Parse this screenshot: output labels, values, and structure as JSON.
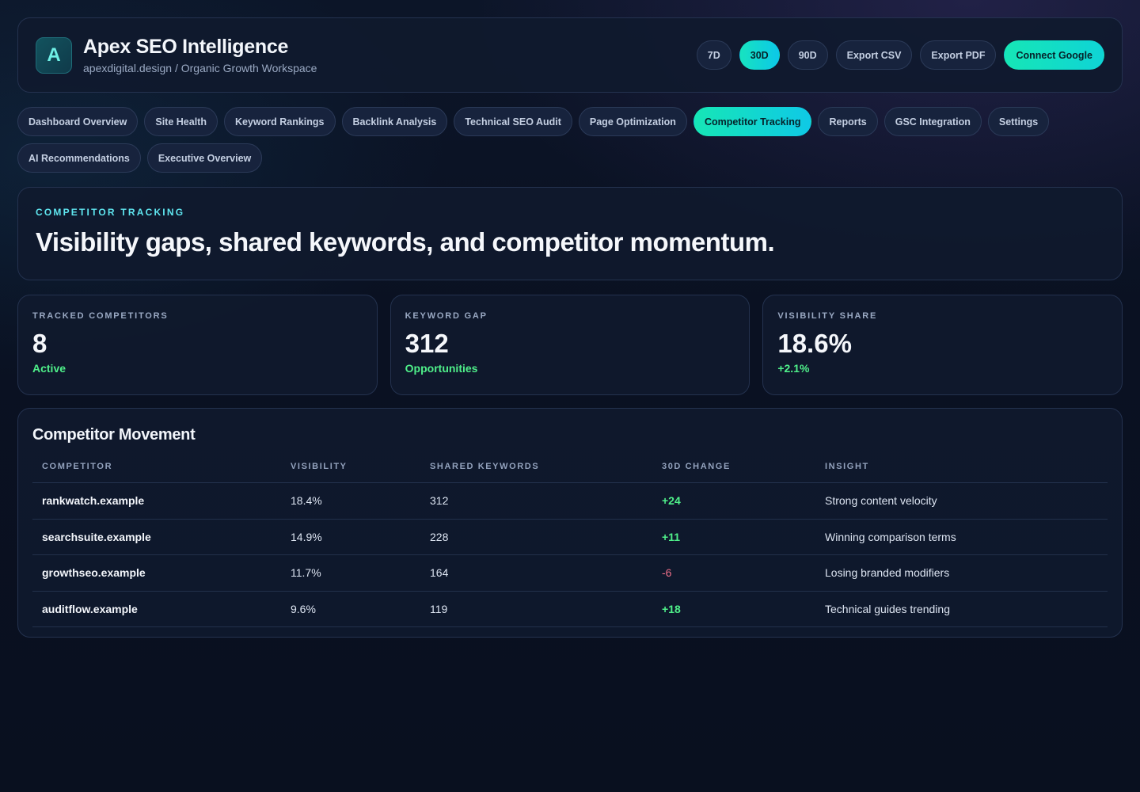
{
  "brand": {
    "logo_letter": "A",
    "title": "Apex SEO Intelligence",
    "subtitle": "apexdigital.design / Organic Growth Workspace"
  },
  "header_actions": {
    "range_7d": "7D",
    "range_30d": "30D",
    "range_90d": "90D",
    "export_csv": "Export CSV",
    "export_pdf": "Export PDF",
    "connect_google": "Connect Google"
  },
  "tabs": [
    {
      "label": "Dashboard Overview"
    },
    {
      "label": "Site Health"
    },
    {
      "label": "Keyword Rankings"
    },
    {
      "label": "Backlink Analysis"
    },
    {
      "label": "Technical SEO Audit"
    },
    {
      "label": "Page Optimization"
    },
    {
      "label": "Competitor Tracking",
      "active": true
    },
    {
      "label": "Reports"
    },
    {
      "label": "GSC Integration"
    },
    {
      "label": "Settings"
    },
    {
      "label": "AI Recommendations"
    },
    {
      "label": "Executive Overview"
    }
  ],
  "hero": {
    "eyebrow": "COMPETITOR TRACKING",
    "title": "Visibility gaps, shared keywords, and competitor momentum."
  },
  "stats": [
    {
      "label": "TRACKED COMPETITORS",
      "value": "8",
      "sub": "Active"
    },
    {
      "label": "KEYWORD GAP",
      "value": "312",
      "sub": "Opportunities"
    },
    {
      "label": "VISIBILITY SHARE",
      "value": "18.6%",
      "sub": "+2.1%"
    }
  ],
  "movement": {
    "title": "Competitor Movement",
    "columns": [
      "COMPETITOR",
      "VISIBILITY",
      "SHARED KEYWORDS",
      "30D CHANGE",
      "INSIGHT"
    ],
    "rows": [
      {
        "competitor": "rankwatch.example",
        "visibility": "18.4%",
        "shared": "312",
        "change": "+24",
        "insight": "Strong content velocity"
      },
      {
        "competitor": "searchsuite.example",
        "visibility": "14.9%",
        "shared": "228",
        "change": "+11",
        "insight": "Winning comparison terms"
      },
      {
        "competitor": "growthseo.example",
        "visibility": "11.7%",
        "shared": "164",
        "change": "-6",
        "insight": "Losing branded modifiers"
      },
      {
        "competitor": "auditflow.example",
        "visibility": "9.6%",
        "shared": "119",
        "change": "+18",
        "insight": "Technical guides trending"
      }
    ]
  },
  "colors": {
    "accent": "#16e6b6",
    "positive": "#4ff08a",
    "negative": "#f0708a",
    "eyebrow": "#5fe6f0"
  }
}
